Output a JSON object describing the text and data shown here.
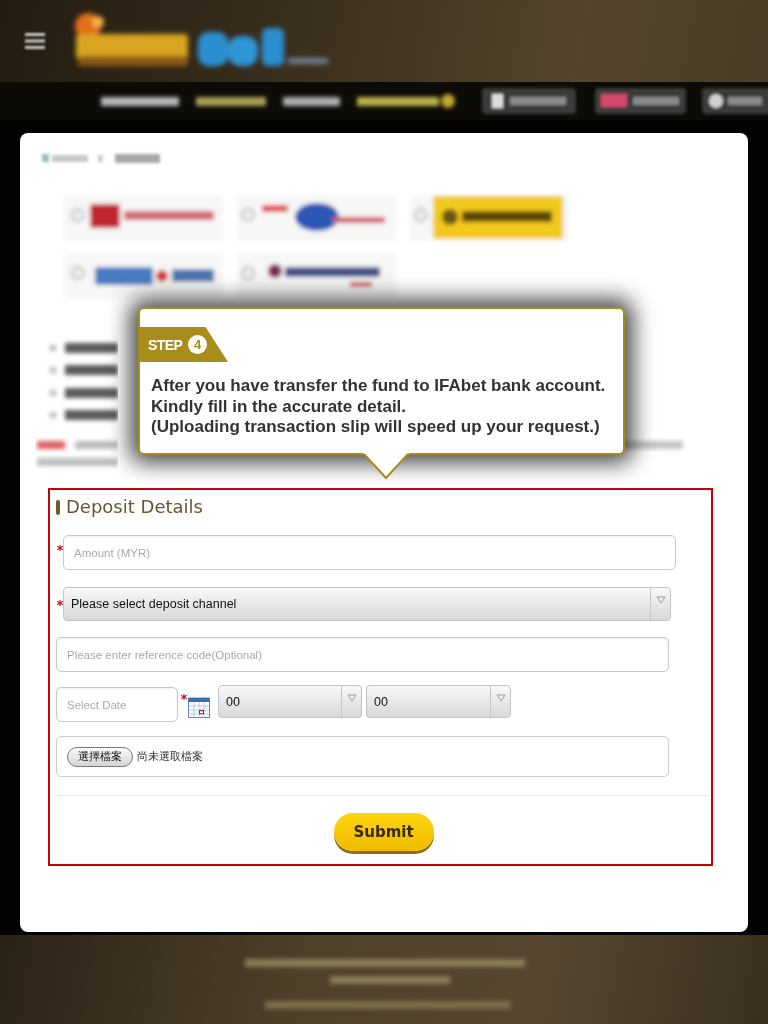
{
  "tutorial": {
    "step_label": "STEP",
    "step_number": "4",
    "lines": [
      "After you have transfer the fund to IFAbet bank account.",
      "Kindly fill in the accurate detail.",
      "(Uploading transaction slip will speed up your request.)"
    ]
  },
  "deposit_form": {
    "title": "Deposit Details",
    "rows": [
      {
        "kind": "input",
        "required": true,
        "placeholder": "Amount (MYR)"
      },
      {
        "kind": "select",
        "required": true,
        "value": "Please select deposit channel"
      },
      {
        "kind": "input",
        "required": false,
        "placeholder": "Please enter reference code(Optional)"
      },
      {
        "kind": "datetime",
        "required": true,
        "placeholder": "Select Date",
        "selects": [
          "00",
          "00"
        ]
      },
      {
        "kind": "file",
        "button_label": "選擇檔案",
        "status": "尚未選取檔案"
      }
    ],
    "submit_label": "Submit"
  }
}
